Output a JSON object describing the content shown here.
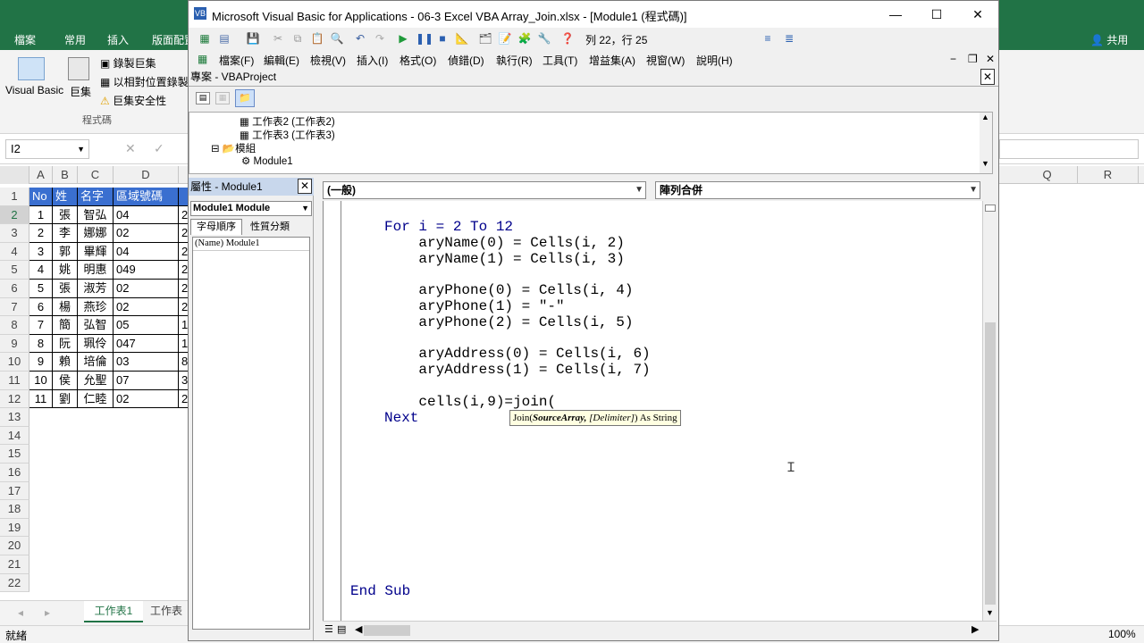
{
  "excel": {
    "tabs": [
      "檔案",
      "常用",
      "插入",
      "版面配置"
    ],
    "ribbon": {
      "visual_basic": "Visual Basic",
      "macros": "巨集",
      "record_macro": "錄製巨集",
      "relative_ref": "以相對位置錄製",
      "macro_security": "巨集安全性",
      "group_label": "程式碼"
    },
    "name_box": "I2",
    "columns": [
      "A",
      "B",
      "C",
      "D",
      "Q",
      "R"
    ],
    "table_header": [
      "No",
      "姓",
      "名字",
      "區域號碼"
    ],
    "rows": [
      [
        "1",
        "張",
        "智弘",
        "04"
      ],
      [
        "2",
        "李",
        "娜娜",
        "02"
      ],
      [
        "3",
        "郭",
        "畢輝",
        "04"
      ],
      [
        "4",
        "姚",
        "明惠",
        "049"
      ],
      [
        "5",
        "張",
        "淑芳",
        "02"
      ],
      [
        "6",
        "楊",
        "燕珍",
        "02"
      ],
      [
        "7",
        "簡",
        "弘智",
        "05"
      ],
      [
        "8",
        "阮",
        "珮伶",
        "047"
      ],
      [
        "9",
        "賴",
        "培倫",
        "03"
      ],
      [
        "10",
        "侯",
        "允聖",
        "07"
      ],
      [
        "11",
        "劉",
        "仁睦",
        "02"
      ]
    ],
    "row_numbers": [
      "1",
      "2",
      "3",
      "4",
      "5",
      "6",
      "7",
      "8",
      "9",
      "10",
      "11",
      "12",
      "13",
      "14",
      "15",
      "16",
      "17",
      "18",
      "19",
      "20",
      "21",
      "22"
    ],
    "col_e_fragments": [
      "2",
      "2",
      "2",
      "2",
      "2",
      "2",
      "1",
      "1",
      "8",
      "3",
      "2"
    ],
    "sheet_tabs": [
      "工作表1",
      "工作表"
    ],
    "status": "就緒",
    "zoom": "100%",
    "share": "共用"
  },
  "vbe": {
    "title": "Microsoft Visual Basic for Applications - 06-3 Excel VBA Array_Join.xlsx - [Module1 (程式碼)]",
    "cursor_pos": "列 22，行 25",
    "menus": [
      "檔案(F)",
      "編輯(E)",
      "檢視(V)",
      "插入(I)",
      "格式(O)",
      "偵錯(D)",
      "執行(R)",
      "工具(T)",
      "增益集(A)",
      "視窗(W)",
      "說明(H)"
    ],
    "project_title": "專案 - VBAProject",
    "tree": [
      "工作表2 (工作表2)",
      "工作表3 (工作表3)",
      "模組",
      "Module1"
    ],
    "props_title": "屬性 - Module1",
    "props_combo": "Module1  Module",
    "props_tab_alpha": "字母順序",
    "props_tab_cat": "性質分類",
    "props_name_key": "(Name)",
    "props_name_val": "Module1",
    "object_combo": "(一般)",
    "proc_combo": "陣列合併",
    "code": [
      "For i = 2 To 12",
      "    aryName(0) = Cells(i, 2)",
      "    aryName(1) = Cells(i, 3)",
      "",
      "    aryPhone(0) = Cells(i, 4)",
      "    aryPhone(1) = \"-\"",
      "    aryPhone(2) = Cells(i, 5)",
      "",
      "    aryAddress(0) = Cells(i, 6)",
      "    aryAddress(1) = Cells(i, 7)",
      "",
      "    cells(i,9)=join(",
      "Next"
    ],
    "end_sub": "End Sub",
    "tooltip_pre": "Join(",
    "tooltip_arg1": "SourceArray,",
    "tooltip_arg2": "[Delimiter]",
    "tooltip_post": ") As String"
  }
}
